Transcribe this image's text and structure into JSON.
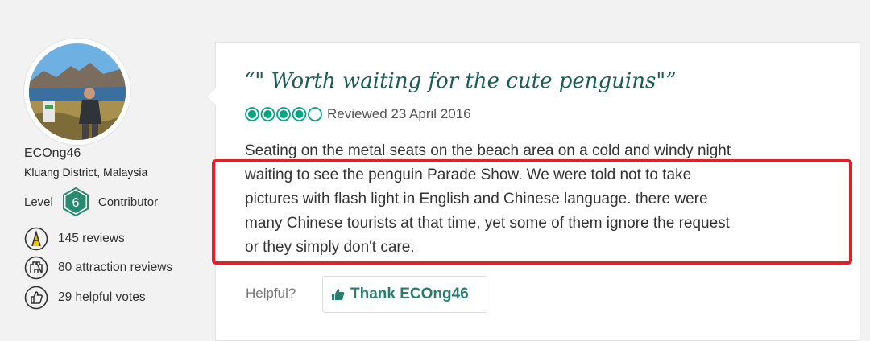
{
  "reviewer": {
    "username": "ECOng46",
    "location": "Kluang District, Malaysia",
    "level_label": "Level",
    "level_number": "6",
    "contributor_label": "Contributor",
    "stats": [
      {
        "icon": "pen-icon",
        "text": "145 reviews"
      },
      {
        "icon": "attraction-icon",
        "text": "80 attraction reviews"
      },
      {
        "icon": "thumbs-up-icon",
        "text": "29 helpful votes"
      }
    ]
  },
  "review": {
    "title": "“\" Worth waiting for the cute penguins\"”",
    "rating": 4,
    "rating_max": 5,
    "reviewed_date": "Reviewed 23 April 2016",
    "lines": [
      "Seating on the metal seats on the beach area on a cold and windy night",
      "waiting to see the penguin Parade Show. We were told not to take",
      "pictures with flash light in English and Chinese language. there were",
      "many Chinese tourists at that time, yet some of them ignore the request",
      "or they simply don't care."
    ],
    "helpful_label": "Helpful?",
    "thank_button_label": "Thank ECOng46"
  },
  "colors": {
    "accent_green": "#1b5c53",
    "bubble_green": "#00a680",
    "button_green": "#2a7c6e",
    "highlight_red": "#e32027"
  }
}
